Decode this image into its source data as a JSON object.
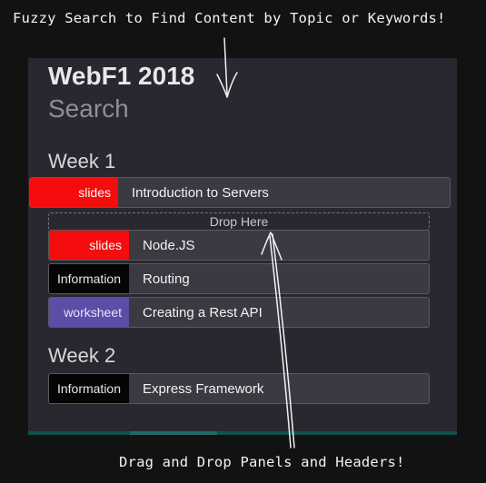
{
  "annotations": {
    "top": "Fuzzy Search to Find Content by Topic or Keywords!",
    "bottom": "Drag and Drop Panels and Headers!"
  },
  "app": {
    "title": "WebF1 2018",
    "search_label": "Search",
    "drop_zone_label": "Drop Here",
    "weeks": [
      {
        "header": "Week 1",
        "panels": [
          {
            "tag": "slides",
            "label": "Introduction to Servers"
          },
          {
            "tag": "slides",
            "label": "Node.JS"
          },
          {
            "tag": "Information",
            "label": "Routing"
          },
          {
            "tag": "worksheet",
            "label": "Creating a Rest API"
          }
        ]
      },
      {
        "header": "Week 2",
        "panels": [
          {
            "tag": "Information",
            "label": "Express Framework"
          }
        ]
      }
    ]
  },
  "colors": {
    "background": "#121212",
    "app_background": "#29272f",
    "panel_background": "#3b3942",
    "slides_tag": "#f50d0d",
    "information_tag": "#050505",
    "worksheet_tag": "#5a4ea6",
    "bottom_bar": "#11504d"
  },
  "icons": {
    "top_annotation_arrow": "hand-drawn-down-arrow-icon",
    "bottom_annotation_arrow": "hand-drawn-up-arrow-icon"
  }
}
